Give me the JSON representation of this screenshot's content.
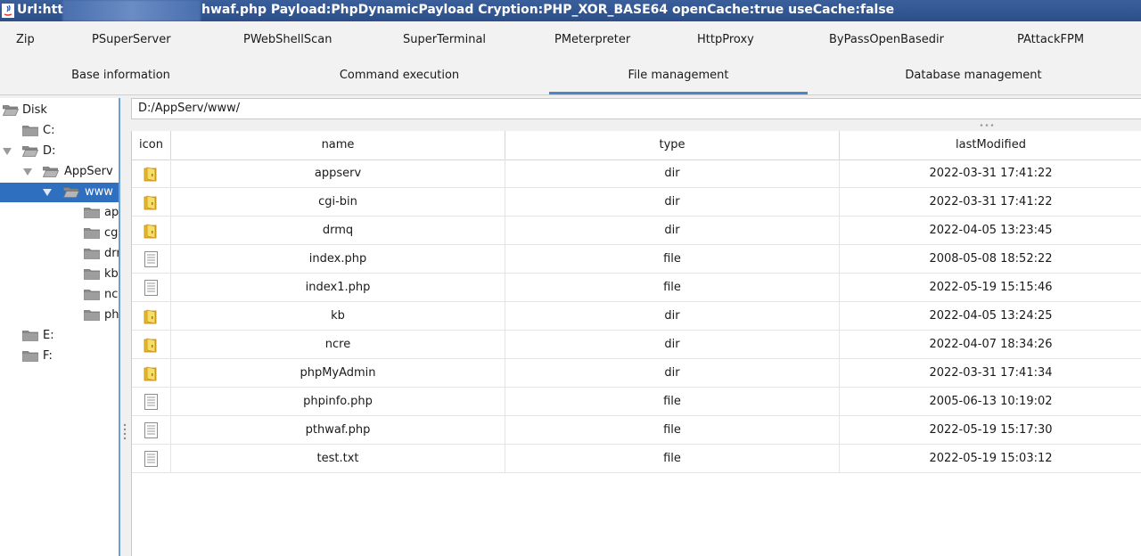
{
  "window": {
    "title_left": "Url:http",
    "title_right": "hwaf.php Payload:PhpDynamicPayload Cryption:PHP_XOR_BASE64 openCache:true useCache:false"
  },
  "plugins": [
    "Zip",
    "PSuperServer",
    "PWebShellScan",
    "SuperTerminal",
    "PMeterpreter",
    "HttpProxy",
    "ByPassOpenBasedir",
    "PAttackFPM"
  ],
  "tabs": [
    "Base information",
    "Command execution",
    "File management",
    "Database management"
  ],
  "active_tab": "File management",
  "tree": {
    "root": "Disk",
    "c": "C:",
    "d": "D:",
    "appserv": "AppServ",
    "www": "www",
    "children": [
      "ap",
      "cgi",
      "drr",
      "kb",
      "ncı",
      "ph"
    ],
    "e": "E:",
    "f": "F:"
  },
  "path": "D:/AppServ/www/",
  "table": {
    "headers": [
      "icon",
      "name",
      "type",
      "lastModified"
    ],
    "rows": [
      {
        "icon": "folder-icon",
        "name": "appserv",
        "type": "dir",
        "modified": "2022-03-31 17:41:22"
      },
      {
        "icon": "folder-icon",
        "name": "cgi-bin",
        "type": "dir",
        "modified": "2022-03-31 17:41:22"
      },
      {
        "icon": "folder-icon",
        "name": "drmq",
        "type": "dir",
        "modified": "2022-04-05 13:23:45"
      },
      {
        "icon": "file-icon",
        "name": "index.php",
        "type": "file",
        "modified": "2008-05-08 18:52:22"
      },
      {
        "icon": "file-icon",
        "name": "index1.php",
        "type": "file",
        "modified": "2022-05-19 15:15:46"
      },
      {
        "icon": "folder-icon",
        "name": "kb",
        "type": "dir",
        "modified": "2022-04-05 13:24:25"
      },
      {
        "icon": "folder-icon",
        "name": "ncre",
        "type": "dir",
        "modified": "2022-04-07 18:34:26"
      },
      {
        "icon": "folder-icon",
        "name": "phpMyAdmin",
        "type": "dir",
        "modified": "2022-03-31 17:41:34"
      },
      {
        "icon": "file-icon",
        "name": "phpinfo.php",
        "type": "file",
        "modified": "2005-06-13 10:19:02"
      },
      {
        "icon": "file-icon",
        "name": "pthwaf.php",
        "type": "file",
        "modified": "2022-05-19 15:17:30"
      },
      {
        "icon": "file-icon",
        "name": "test.txt",
        "type": "file",
        "modified": "2022-05-19 15:03:12"
      }
    ]
  },
  "colors": {
    "titlebar": "#2c4f8a",
    "selection": "#2f6fbf",
    "tab_indicator": "#4a86c5",
    "folder": "#f2c94c"
  }
}
